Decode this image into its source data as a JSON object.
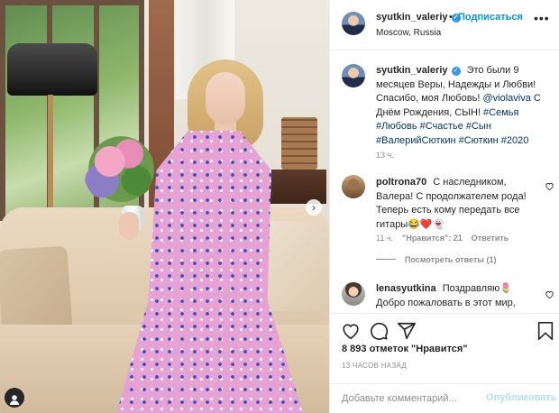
{
  "post": {
    "owner": "syutkin_valeriy",
    "follow_label": "Подписаться",
    "location": "Moscow, Russia",
    "more_label": "•••"
  },
  "caption": {
    "user": "syutkin_valeriy",
    "text_before": "Это были 9 месяцев Веры, Надежды и Любви! Спасибо, моя Любовь!",
    "mention": "@violaviva",
    "text_after": "С Днём Рождения, СЫН!",
    "hashtags": "#Семья #Любовь #Счастье #Сын #ВалерийСюткин #Сюткин #2020",
    "time": "13 ч."
  },
  "comments": [
    {
      "user": "poltrona70",
      "text": "С наследником, Валера! С продолжателем рода! Теперь есть кому передать все гитары😂❤️👻",
      "time": "11 ч.",
      "likes": "\"Нравится\": 21",
      "reply": "Ответить",
      "view_replies": "Посмотреть ответы (1)"
    },
    {
      "user": "lenasyutkina",
      "text": "Поздравляю🌷 Добро пожаловать в этот мир,"
    }
  ],
  "stats": {
    "likes": "8 893 отметок \"Нравится\"",
    "ago": "13 ЧАСОВ НАЗАД"
  },
  "add_comment": {
    "placeholder": "Добавьте комментарий...",
    "post_label": "Опубликовать"
  },
  "icons": {
    "verified": "verified-badge-icon",
    "like": "heart-icon",
    "comment": "comment-icon",
    "share": "share-icon",
    "save": "bookmark-icon",
    "user_tag": "user-tag-icon",
    "next": "chevron-right-icon"
  },
  "colors": {
    "accent": "#0095f6",
    "verified": "#3897f0",
    "muted": "#8e8e8e",
    "text": "#262626"
  }
}
